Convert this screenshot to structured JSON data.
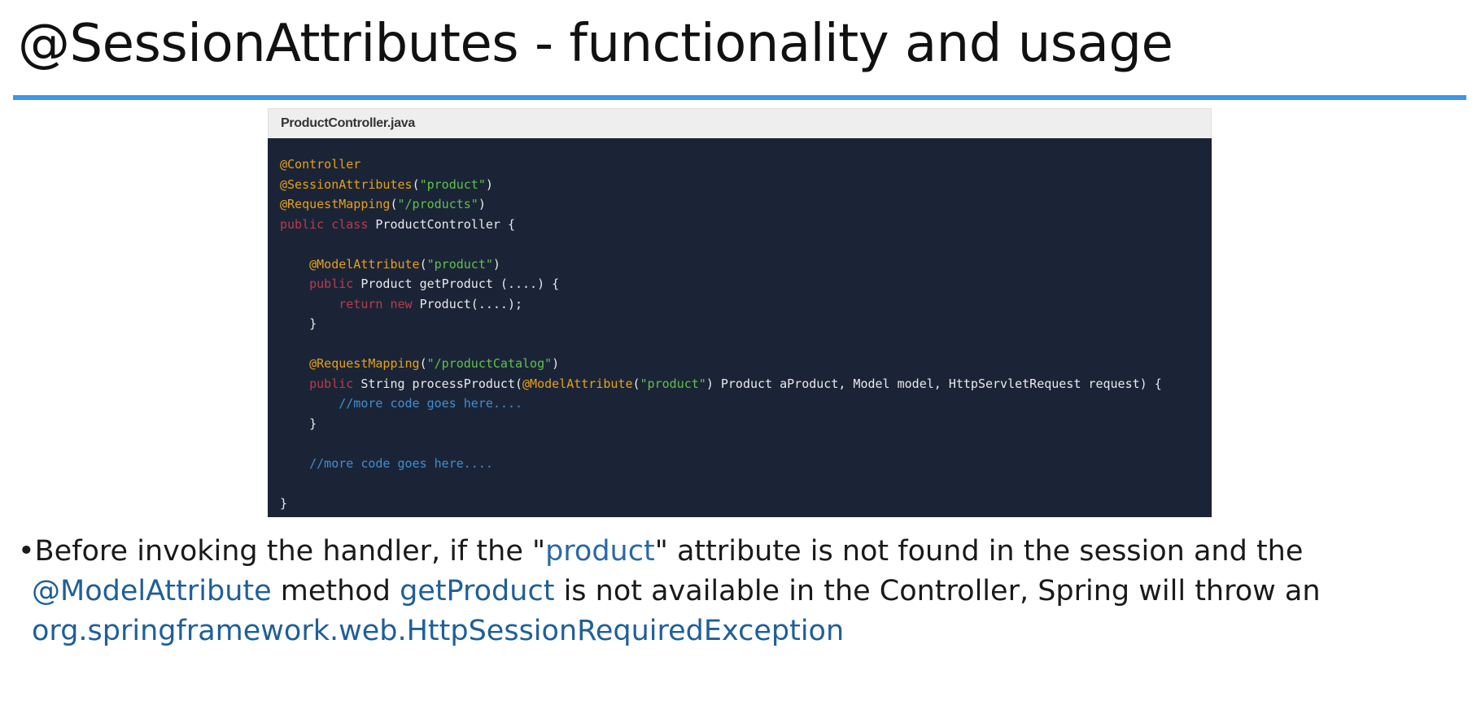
{
  "slide": {
    "title": "@SessionAttributes - functionality and usage"
  },
  "code_panel": {
    "filename": "ProductController.java",
    "lines": [
      [
        {
          "t": "ann",
          "v": "@Controller"
        }
      ],
      [
        {
          "t": "ann",
          "v": "@SessionAttributes"
        },
        {
          "t": "plain",
          "v": "("
        },
        {
          "t": "str",
          "v": "\"product\""
        },
        {
          "t": "plain",
          "v": ")"
        }
      ],
      [
        {
          "t": "ann",
          "v": "@RequestMapping"
        },
        {
          "t": "plain",
          "v": "("
        },
        {
          "t": "str",
          "v": "\"/products\""
        },
        {
          "t": "plain",
          "v": ")"
        }
      ],
      [
        {
          "t": "kw",
          "v": "public"
        },
        {
          "t": "plain",
          "v": " "
        },
        {
          "t": "kw",
          "v": "class"
        },
        {
          "t": "plain",
          "v": " ProductController {"
        }
      ],
      [],
      [
        {
          "t": "plain",
          "v": "    "
        },
        {
          "t": "ann",
          "v": "@ModelAttribute"
        },
        {
          "t": "plain",
          "v": "("
        },
        {
          "t": "str",
          "v": "\"product\""
        },
        {
          "t": "plain",
          "v": ")"
        }
      ],
      [
        {
          "t": "plain",
          "v": "    "
        },
        {
          "t": "kw",
          "v": "public"
        },
        {
          "t": "plain",
          "v": " Product getProduct (....) {"
        }
      ],
      [
        {
          "t": "plain",
          "v": "        "
        },
        {
          "t": "kw",
          "v": "return"
        },
        {
          "t": "plain",
          "v": " "
        },
        {
          "t": "kw",
          "v": "new"
        },
        {
          "t": "plain",
          "v": " Product(....);"
        }
      ],
      [
        {
          "t": "plain",
          "v": "    }"
        }
      ],
      [],
      [
        {
          "t": "plain",
          "v": "    "
        },
        {
          "t": "ann",
          "v": "@RequestMapping"
        },
        {
          "t": "plain",
          "v": "("
        },
        {
          "t": "str",
          "v": "\"/productCatalog\""
        },
        {
          "t": "plain",
          "v": ")"
        }
      ],
      [
        {
          "t": "plain",
          "v": "    "
        },
        {
          "t": "kw",
          "v": "public"
        },
        {
          "t": "plain",
          "v": " String processProduct("
        },
        {
          "t": "ann",
          "v": "@ModelAttribute"
        },
        {
          "t": "plain",
          "v": "("
        },
        {
          "t": "str",
          "v": "\"product\""
        },
        {
          "t": "plain",
          "v": ") Product aProduct, Model model, HttpServletRequest request) {"
        }
      ],
      [
        {
          "t": "plain",
          "v": "        "
        },
        {
          "t": "com",
          "v": "//more code goes here...."
        }
      ],
      [
        {
          "t": "plain",
          "v": "    }"
        }
      ],
      [],
      [
        {
          "t": "plain",
          "v": "    "
        },
        {
          "t": "com",
          "v": "//more code goes here...."
        }
      ],
      [],
      [
        {
          "t": "plain",
          "v": "}"
        }
      ]
    ]
  },
  "bullet": {
    "marker": "•",
    "line1_a": "Before invoking the handler, if the \"",
    "line1_hl": "product",
    "line1_b": "\" attribute is not found in the session and the",
    "line2_hl1": "@ModelAttribute",
    "line2_a": " method ",
    "line2_hl2": "getProduct",
    "line2_b": " is not available in the Controller, Spring will throw an",
    "line3_hl": "org.springframework.web.HttpSessionRequiredException"
  },
  "colors": {
    "title_rule": "#3c97e4",
    "code_background": "#1b2436",
    "annotation": "#e6a019",
    "string": "#5fc04d",
    "keyword": "#b73c4c",
    "comment": "#3d8fd6",
    "bullet_highlight": "#1f5f99"
  }
}
